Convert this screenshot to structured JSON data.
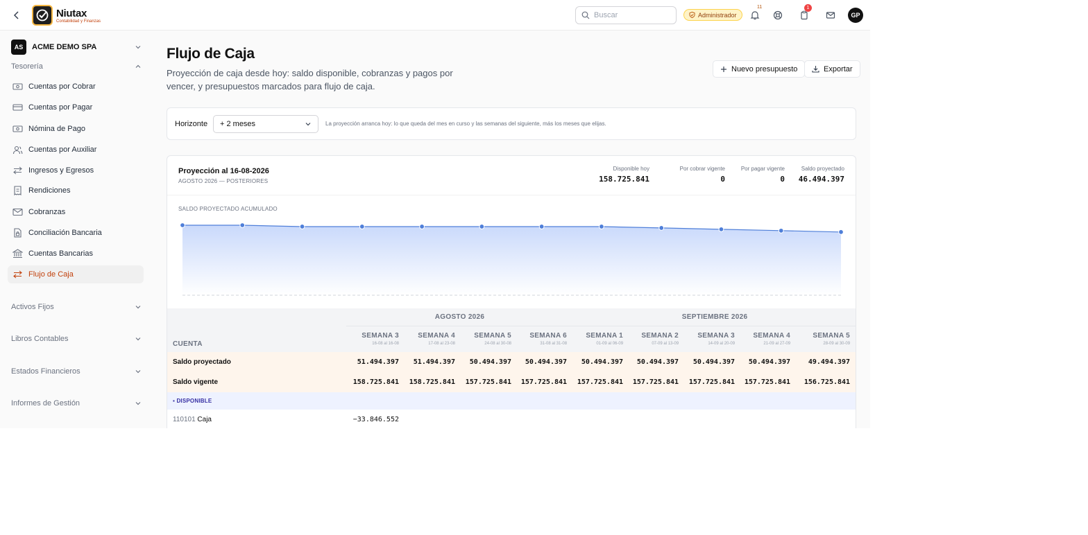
{
  "topbar": {
    "brand_name": "Niutax",
    "brand_tagline": "Contabilidad y Finanzas",
    "search_placeholder": "Buscar",
    "role": "Administrador",
    "notifications_count": "11",
    "tasks_count": "1",
    "user_initials": "GP",
    "colors": {
      "brand": "#f5b642",
      "alert": "#ef4444"
    }
  },
  "sidebar": {
    "company": {
      "initials": "AS",
      "name": "ACME DEMO SPA"
    },
    "section": "Tesorería",
    "items": [
      {
        "label": "Cuentas por Cobrar",
        "icon": "banknote-icon"
      },
      {
        "label": "Cuentas por Pagar",
        "icon": "credit-card-icon"
      },
      {
        "label": "Nómina de Pago",
        "icon": "banknote-icon"
      },
      {
        "label": "Cuentas por Auxiliar",
        "icon": "users-icon"
      },
      {
        "label": "Ingresos y Egresos",
        "icon": "arrows-icon"
      },
      {
        "label": "Rendiciones",
        "icon": "receipt-icon"
      },
      {
        "label": "Cobranzas",
        "icon": "mail-icon"
      },
      {
        "label": "Conciliación Bancaria",
        "icon": "file-lock-icon"
      },
      {
        "label": "Cuentas Bancarias",
        "icon": "bank-icon"
      },
      {
        "label": "Flujo de Caja",
        "icon": "arrows-icon",
        "active": true
      }
    ],
    "collapsed_sections": [
      "Activos Fijos",
      "Libros Contables",
      "Estados Financieros",
      "Informes de Gestión"
    ]
  },
  "page": {
    "title": "Flujo de Caja",
    "subtitle": "Proyección de caja desde hoy: saldo disponible, cobranzas y pagos por vencer, y presupuestos marcados para flujo de caja.",
    "new_budget_label": "Nuevo presupuesto",
    "export_label": "Exportar"
  },
  "horizon": {
    "label": "Horizonte",
    "selected": "+ 2 meses",
    "note": "La proyección arranca hoy: lo que queda del mes en curso y las semanas del siguiente, más los meses que elijas."
  },
  "projection": {
    "title": "Proyección al 16-08-2026",
    "subtitle": "AGOSTO 2026 — POSTERIORES",
    "kpis": [
      {
        "label": "Disponible hoy",
        "value": "158.725.841"
      },
      {
        "label": "Por cobrar vigente",
        "value": "0"
      },
      {
        "label": "Por pagar vigente",
        "value": "0"
      },
      {
        "label": "Saldo proyectado",
        "value": "46.494.397"
      }
    ],
    "chart_title": "SALDO PROYECTADO ACUMULADO"
  },
  "chart_data": {
    "type": "area",
    "title": "SALDO PROYECTADO ACUMULADO",
    "series": [
      {
        "values": [
          51494397,
          51494397,
          50494397,
          50494397,
          50494397,
          50494397,
          50494397,
          50494397,
          49494397,
          48494397,
          47494397,
          46494397
        ]
      }
    ],
    "ylim": [
      0,
      51494397
    ],
    "grid": false,
    "colors": {
      "line": "#4f7fd9",
      "fill_top": "#c9d9fb",
      "fill_bottom": "#ffffff"
    }
  },
  "table": {
    "account_header": "CUENTA",
    "months": [
      {
        "label": "AGOSTO 2026",
        "span": 4
      },
      {
        "label": "SEPTIEMBRE 2026",
        "span": 5
      }
    ],
    "weeks": [
      {
        "name": "SEMANA 3",
        "range": "16-08 al 16-08"
      },
      {
        "name": "SEMANA 4",
        "range": "17-08 al 23-08"
      },
      {
        "name": "SEMANA 5",
        "range": "24-08 al 30-08"
      },
      {
        "name": "SEMANA 6",
        "range": "31-08 al 31-08"
      },
      {
        "name": "SEMANA 1",
        "range": "01-09 al 06-09"
      },
      {
        "name": "SEMANA 2",
        "range": "07-09 al 13-09"
      },
      {
        "name": "SEMANA 3",
        "range": "14-09 al 20-09"
      },
      {
        "name": "SEMANA 4",
        "range": "21-09 al 27-09"
      },
      {
        "name": "SEMANA 5",
        "range": "28-09 al 30-09"
      }
    ],
    "summary_rows": [
      {
        "label": "Saldo proyectado",
        "values": [
          "51.494.397",
          "51.494.397",
          "50.494.397",
          "50.494.397",
          "50.494.397",
          "50.494.397",
          "50.494.397",
          "50.494.397",
          "49.494.397"
        ]
      },
      {
        "label": "Saldo vigente",
        "values": [
          "158.725.841",
          "158.725.841",
          "157.725.841",
          "157.725.841",
          "157.725.841",
          "157.725.841",
          "157.725.841",
          "157.725.841",
          "156.725.841"
        ]
      }
    ],
    "group_label": "▪ DISPONIBLE",
    "account_row": {
      "code": "110101",
      "name": "Caja",
      "value": "−33.846.552"
    }
  }
}
